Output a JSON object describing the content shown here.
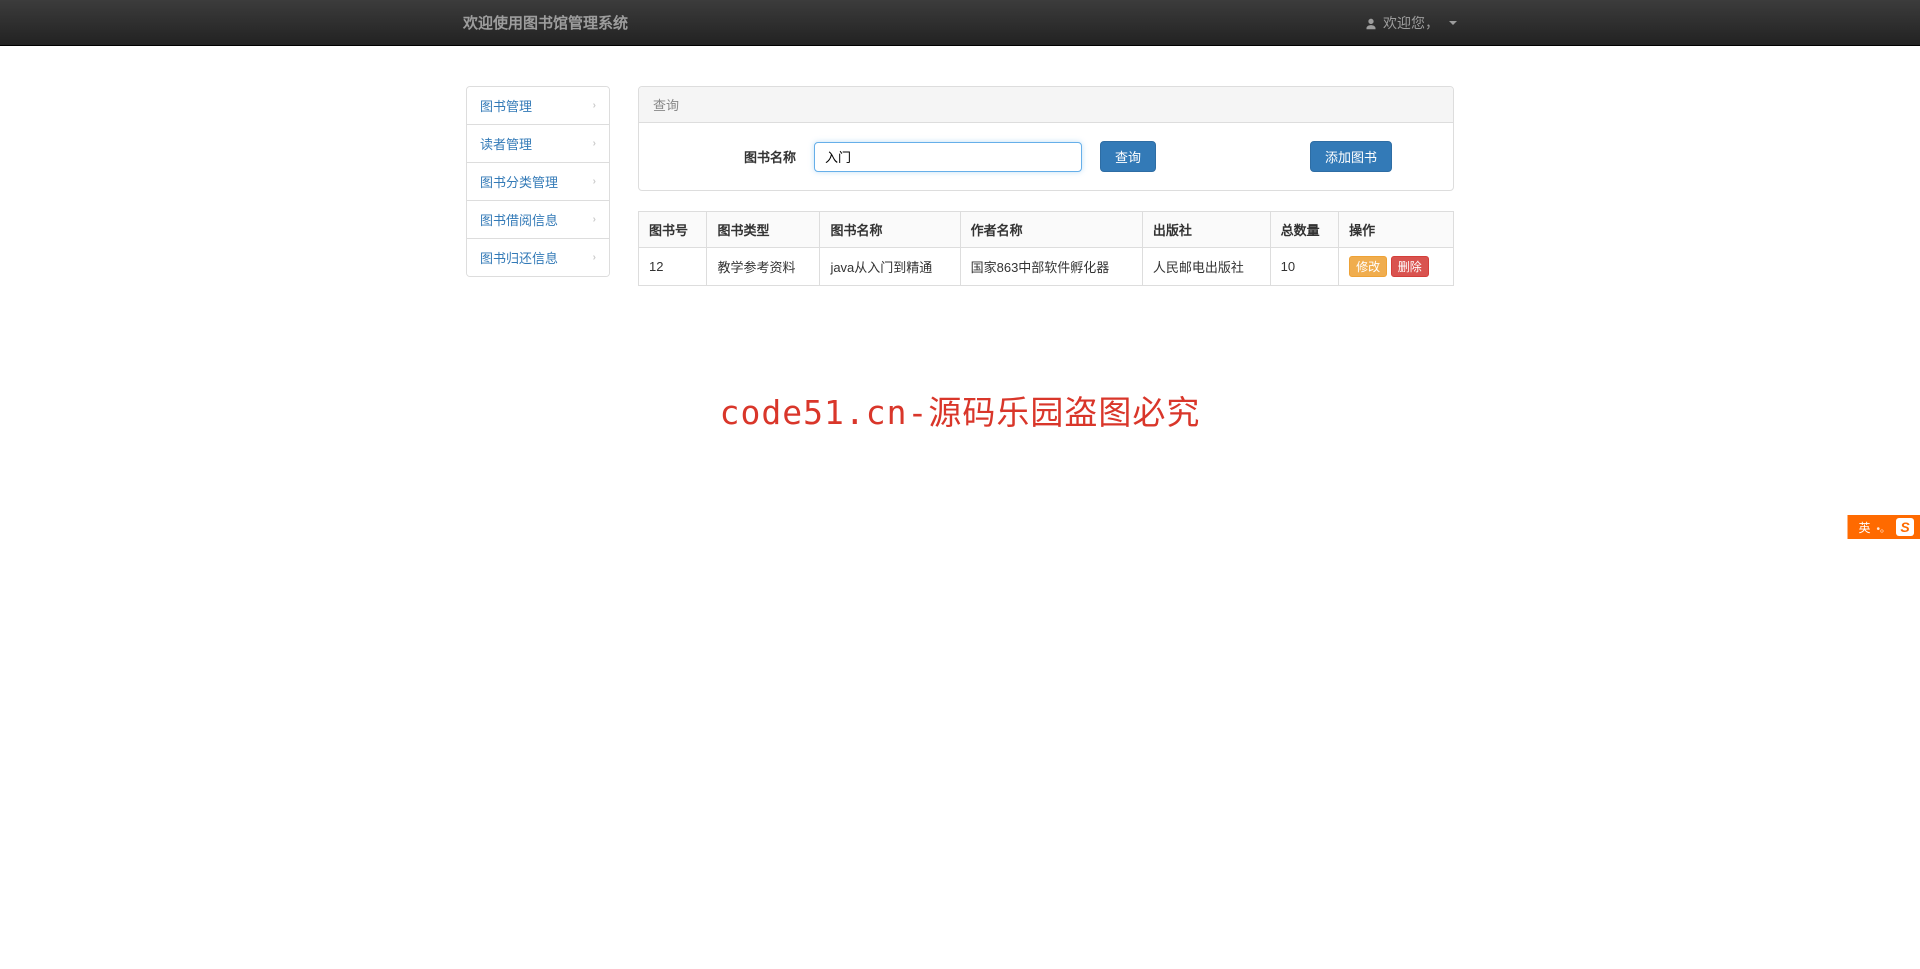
{
  "navbar": {
    "brand": "欢迎使用图书馆管理系统",
    "welcome": "欢迎您，"
  },
  "sidebar": {
    "items": [
      {
        "label": "图书管理"
      },
      {
        "label": "读者管理"
      },
      {
        "label": "图书分类管理"
      },
      {
        "label": "图书借阅信息"
      },
      {
        "label": "图书归还信息"
      }
    ]
  },
  "panel": {
    "title": "查询",
    "search_label": "图书名称",
    "search_value": "入门",
    "search_button": "查询",
    "add_button": "添加图书"
  },
  "table": {
    "headers": [
      "图书号",
      "图书类型",
      "图书名称",
      "作者名称",
      "出版社",
      "总数量",
      "操作"
    ],
    "rows": [
      {
        "id": "12",
        "type": "教学参考资料",
        "name": "java从入门到精通",
        "author": "国家863中部软件孵化器",
        "publisher": "人民邮电出版社",
        "total": "10"
      }
    ],
    "edit_label": "修改",
    "delete_label": "删除"
  },
  "watermark": "code51.cn-源码乐园盗图必究",
  "ime": {
    "lang": "英",
    "punct": "•。",
    "brand": "S"
  }
}
